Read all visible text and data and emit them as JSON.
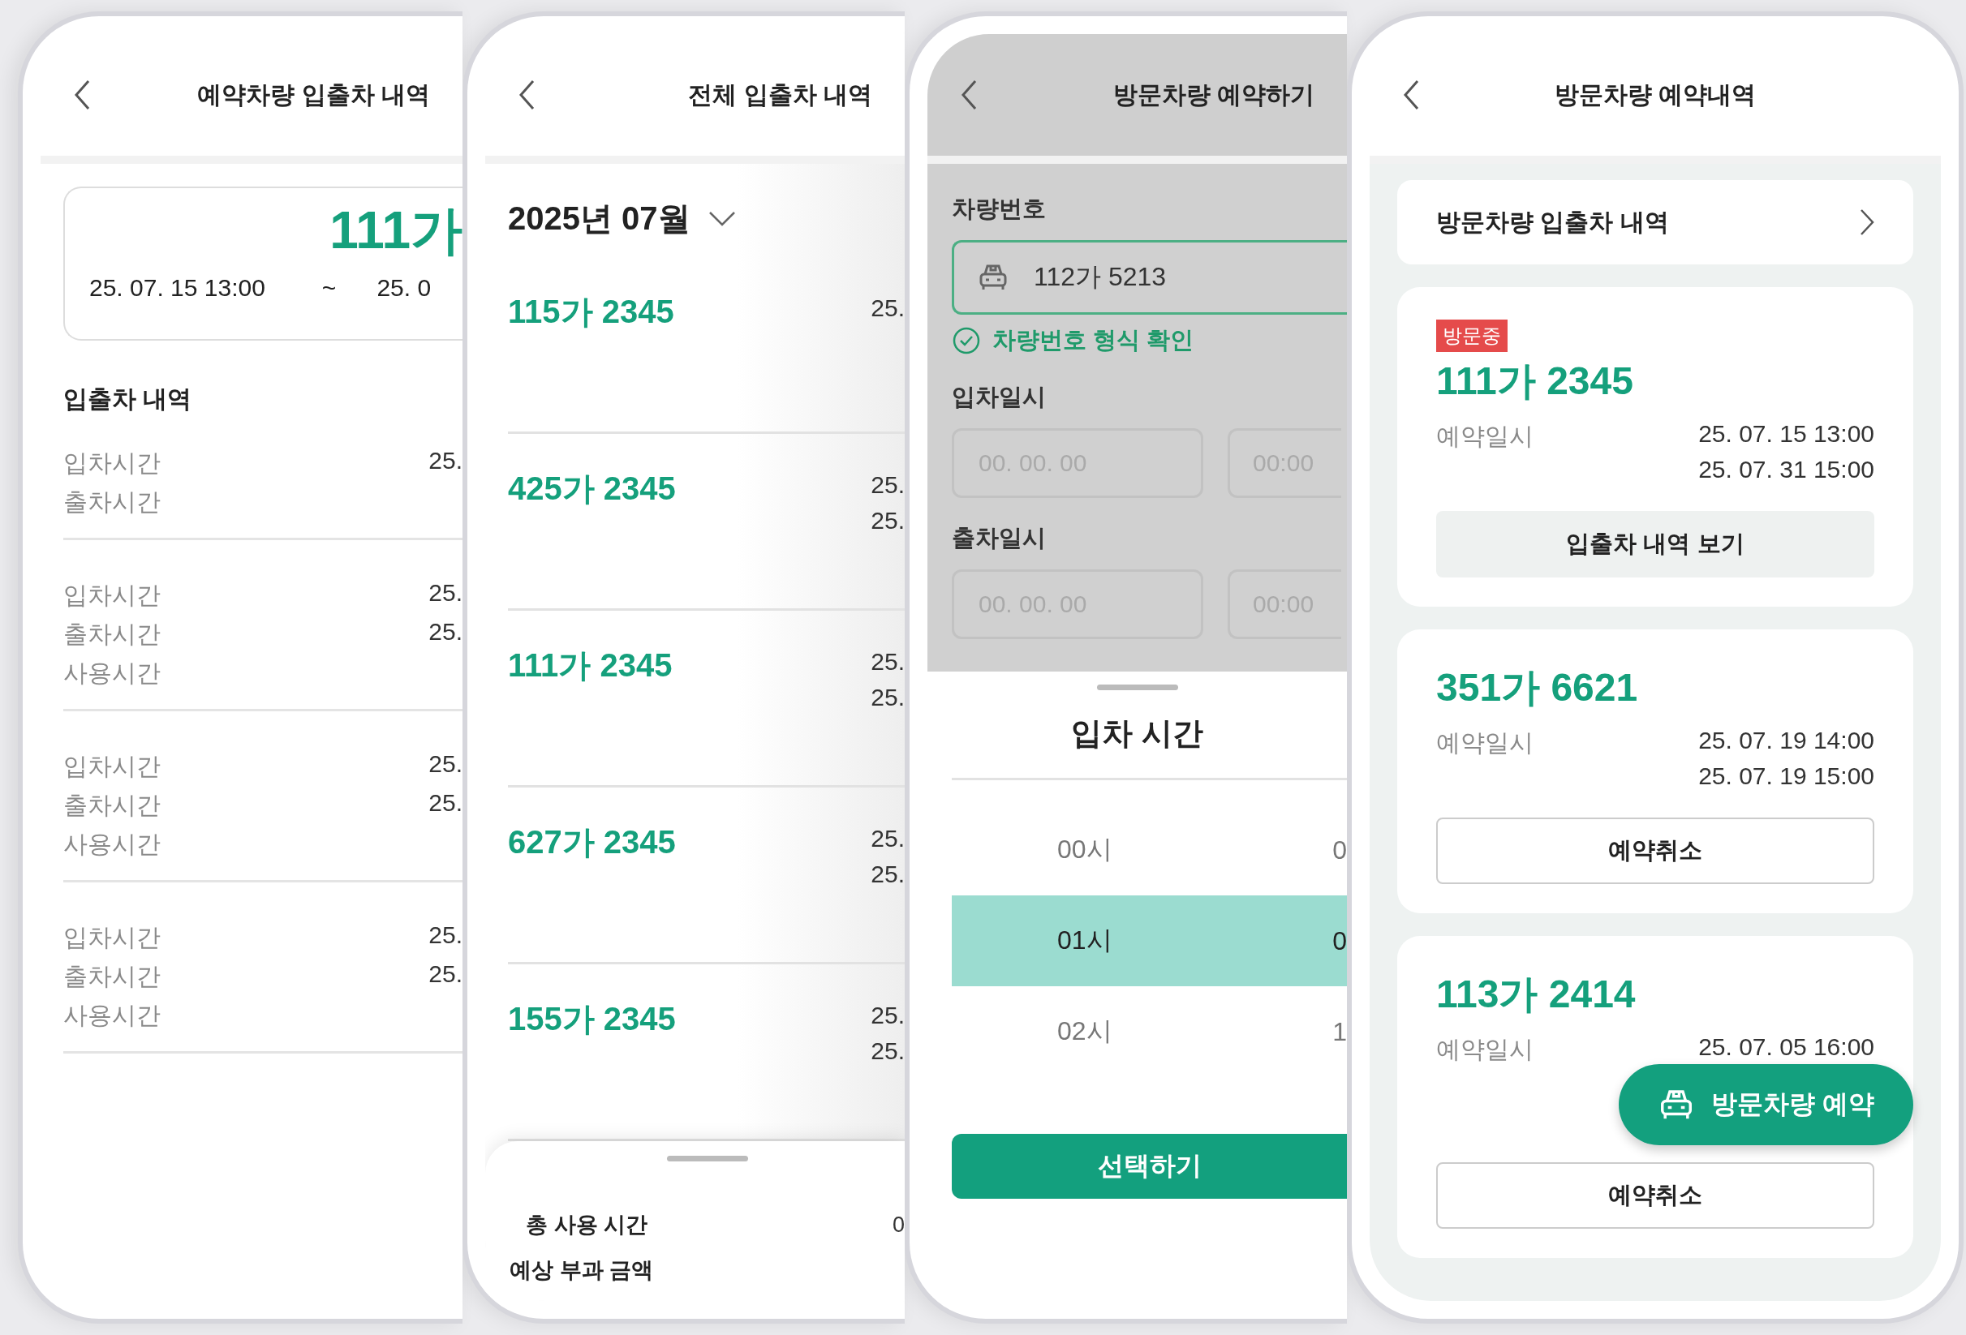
{
  "phones": [
    {
      "kind": "entry_history",
      "title": "예약차량 입출차 내역",
      "plate": "111가",
      "period_start": "25. 07. 15  13:00",
      "period_sep": "~",
      "period_end": "25. 0",
      "section_title": "입출차 내역",
      "groups": [
        {
          "rows": [
            {
              "label": "입차시간",
              "value": "25."
            },
            {
              "label": "출차시간"
            }
          ]
        },
        {
          "rows": [
            {
              "label": "입차시간",
              "value": "25."
            },
            {
              "label": "출차시간",
              "value": "25."
            },
            {
              "label": "사용시간"
            }
          ]
        },
        {
          "rows": [
            {
              "label": "입차시간",
              "value": "25."
            },
            {
              "label": "출차시간",
              "value": "25."
            },
            {
              "label": "사용시간"
            }
          ]
        },
        {
          "rows": [
            {
              "label": "입차시간",
              "value": "25."
            },
            {
              "label": "출차시간",
              "value": "25."
            },
            {
              "label": "사용시간"
            }
          ]
        }
      ]
    },
    {
      "kind": "all_history",
      "title": "전체 입출차 내역",
      "month": "2025년 07월",
      "items": [
        {
          "plate": "115가 2345",
          "times": [
            "25."
          ]
        },
        {
          "plate": "425가 2345",
          "times": [
            "25.",
            "25."
          ]
        },
        {
          "plate": "111가 2345",
          "times": [
            "25.",
            "25."
          ]
        },
        {
          "plate": "627가 2345",
          "times": [
            "25.",
            "25."
          ]
        },
        {
          "plate": "155가 2345",
          "times": [
            "25.",
            "25."
          ]
        }
      ],
      "summary": [
        {
          "label": "총 사용 시간",
          "value": "0"
        },
        {
          "label": "예상 부과 금액"
        }
      ]
    },
    {
      "kind": "reserve_form",
      "title": "방문차량 예약하기",
      "plate_label": "차량번호",
      "plate_value": "112가 5213",
      "plate_valid": true,
      "plate_message": "차량번호 형식 확인",
      "dates": [
        {
          "label": "입차일시",
          "date_placeholder": "00. 00. 00",
          "time_placeholder": "00:00"
        },
        {
          "label": "출차일시",
          "date_placeholder": "00. 00. 00",
          "time_placeholder": "00:00"
        }
      ],
      "picker": {
        "title": "입차 시간",
        "rows": [
          {
            "hour": "00시",
            "minute": "0",
            "selected": false
          },
          {
            "hour": "01시",
            "minute": "0",
            "selected": true
          },
          {
            "hour": "02시",
            "minute": "1",
            "selected": false
          }
        ],
        "button": "선택하기"
      }
    },
    {
      "kind": "reservations",
      "title": "방문차량 예약내역",
      "link": "방문차량 입출차 내역",
      "cards": [
        {
          "badge": "방문중",
          "plate": "111가 2345",
          "label": "예약일시",
          "times": [
            "25. 07. 15  13:00",
            "25. 07. 31  15:00"
          ],
          "button": "입출차 내역 보기",
          "kind": "filled"
        },
        {
          "plate": "351가 6621",
          "label": "예약일시",
          "times": [
            "25. 07. 19  14:00",
            "25. 07. 19  15:00"
          ],
          "button": "예약취소",
          "kind": "outline"
        },
        {
          "plate": "113가 2414",
          "label": "예약일시",
          "times": [
            "25. 07. 05  16:00"
          ],
          "button": "예약취소",
          "kind": "outline"
        }
      ],
      "fab": "방문차량 예약"
    }
  ]
}
